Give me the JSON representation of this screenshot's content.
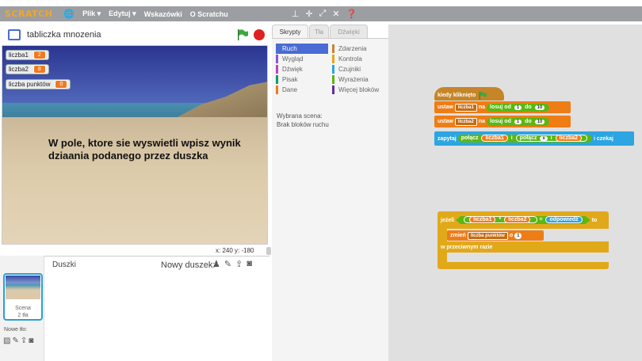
{
  "menu": {
    "logo": "SCRATCH",
    "file": "Plik ▾",
    "edit": "Edytuj ▾",
    "tips": "Wskazówki",
    "about": "O Scratchu"
  },
  "project": {
    "title": "tabliczka mnozenia"
  },
  "stage": {
    "monitors": [
      {
        "label": "liczba1",
        "value": "2"
      },
      {
        "label": "liczba2",
        "value": "8"
      },
      {
        "label": "liczba punktów",
        "value": "0"
      }
    ],
    "text": "W pole, ktore sie wyswietli wpisz wynik dziaania podanego przez duszka",
    "coords": "x: 240   y: -180"
  },
  "sprites": {
    "label": "Duszki",
    "new_sprite": "Nowy duszek:",
    "stage_label": "Scena\n2 tła",
    "new_background": "Nowe tło:"
  },
  "tabs": [
    "Skrypty",
    "Tła",
    "Dźwięki"
  ],
  "categories": [
    {
      "label": "Ruch",
      "color": "#4a6cd4"
    },
    {
      "label": "Zdarzenia",
      "color": "#c88330"
    },
    {
      "label": "Wygląd",
      "color": "#8a55d7"
    },
    {
      "label": "Kontrola",
      "color": "#e1a91a"
    },
    {
      "label": "Dźwięk",
      "color": "#bb42c3"
    },
    {
      "label": "Czujniki",
      "color": "#2ca5e2"
    },
    {
      "label": "Pisak",
      "color": "#0e9a6c"
    },
    {
      "label": "Wyrażenia",
      "color": "#5cb712"
    },
    {
      "label": "Dane",
      "color": "#ee7d16"
    },
    {
      "label": "Więcej bloków",
      "color": "#632d99"
    }
  ],
  "palette_msg": {
    "line1": "Wybrana scena:",
    "line2": "Brak bloków ruchu"
  },
  "script1": {
    "hat": "kiedy kliknięto",
    "set1": {
      "cmd": "ustaw",
      "var": "liczba1",
      "to": "na",
      "rand": "losuj od",
      "from": "1",
      "do": "do",
      "upto": "10"
    },
    "set2": {
      "cmd": "ustaw",
      "var": "liczba2",
      "to": "na",
      "rand": "losuj od",
      "from": "1",
      "do": "do",
      "upto": "10"
    },
    "ask": {
      "cmd": "zapytaj",
      "join1": "połącz",
      "v1": "liczba1",
      "i1": "i",
      "join2": "połącz",
      "x": "x",
      "i2": "i",
      "v2": "liczba2",
      "i3": "i",
      "wait": "i czekaj"
    }
  },
  "script2": {
    "if": "jeżeli",
    "v1": "liczba1",
    "times": "*",
    "v2": "liczba2",
    "eq": "=",
    "answer": "odpowiedź",
    "then": "to",
    "change": "zmień",
    "var": "liczba punktów",
    "by": "o",
    "amount": "1",
    "else": "w przeciwnym razie"
  }
}
